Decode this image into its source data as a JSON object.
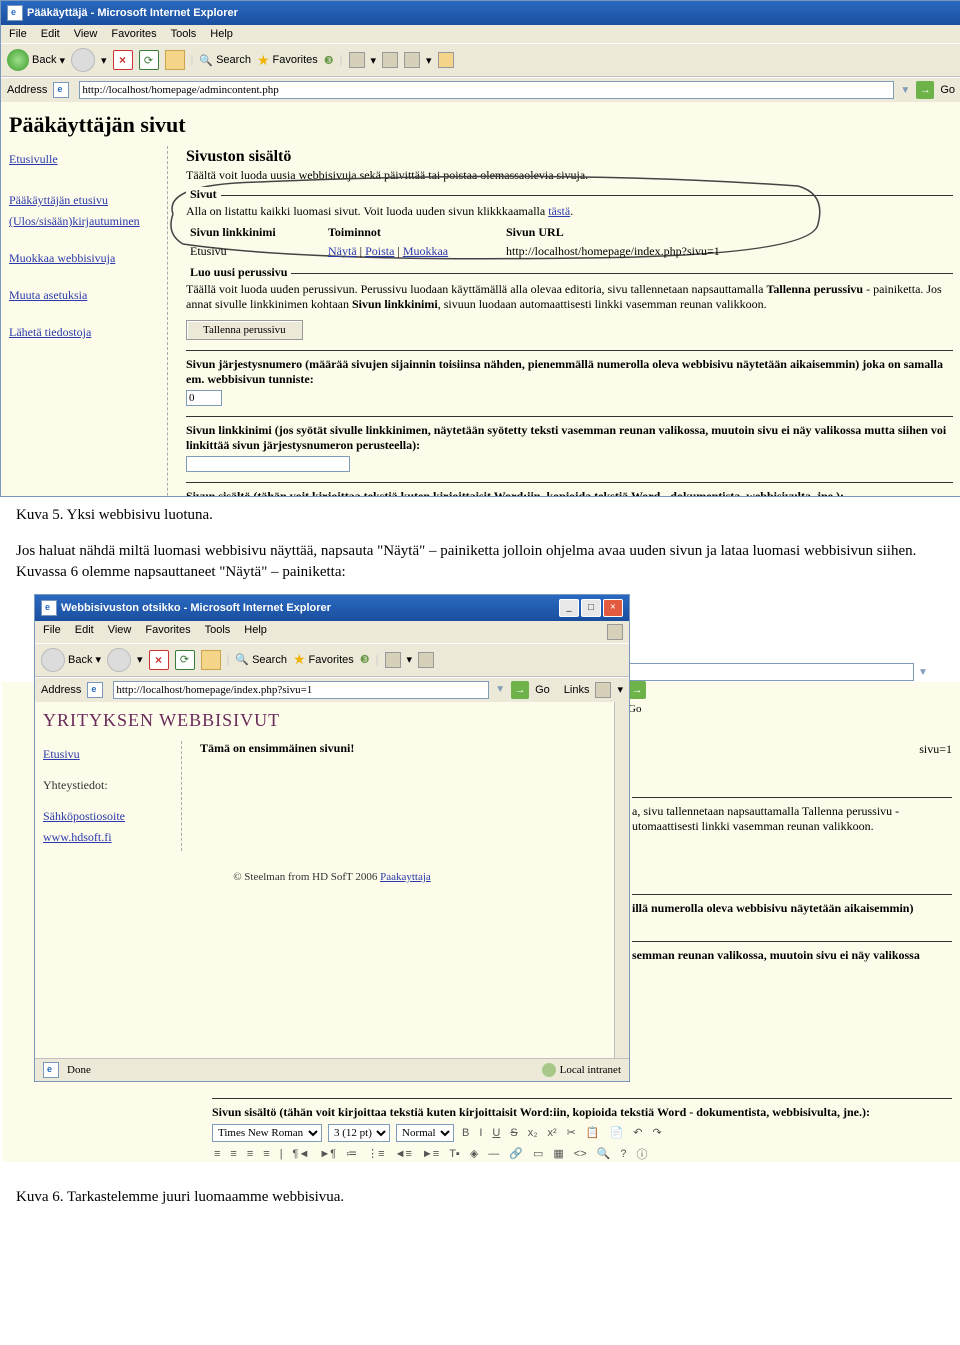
{
  "ie1": {
    "title": "Pääkäyttäjä - Microsoft Internet Explorer",
    "menu": [
      "File",
      "Edit",
      "View",
      "Favorites",
      "Tools",
      "Help"
    ],
    "toolbar": {
      "back": "Back",
      "search": "Search",
      "favorites": "Favorites"
    },
    "address_label": "Address",
    "address_url": "http://localhost/homepage/admincontent.php",
    "go": "Go"
  },
  "page1": {
    "title": "Pääkäyttäjän sivut",
    "side": {
      "home": "Etusivulle",
      "admin": "Pääkäyttäjän etusivu",
      "logout": "(Ulos/sisään)kirjautuminen",
      "edit": "Muokkaa webbisivuja",
      "settings": "Muuta asetuksia",
      "upload": "Lähetä tiedostoja"
    },
    "h2": "Sivuston sisältö",
    "intro": "Täältä voit luoda uusia webbisivuja sekä päivittää tai poistaa olemassaolevia sivuja.",
    "fs1": "Sivut",
    "fs1_txt": "Alla on listattu kaikki luomasi sivut. Voit luoda uuden sivun klikkkaamalla ",
    "fs1_link": "tästä",
    "th": {
      "c1": "Sivun linkkinimi",
      "c2": "Toiminnot",
      "c3": "Sivun URL"
    },
    "row": {
      "c1": "Etusivu",
      "a1": "Näytä",
      "a2": "Poista",
      "a3": "Muokkaa",
      "url": "http://localhost/homepage/index.php?sivu=1"
    },
    "fs2": "Luo uusi perussivu",
    "fs2_txt": "Täällä voit luoda uuden perussivun. Perussivu luodaan käyttämällä alla olevaa editoria, sivu tallennetaan napsauttamalla ",
    "fs2_bold": "Tallenna perussivu",
    "fs2_txt2": " - painiketta. Jos annat sivulle linkkinimen kohtaan ",
    "fs2_bold2": "Sivun linkkinimi",
    "fs2_txt3": ", sivuun luodaan automaattisesti linkki vasemman reunan valikkoon.",
    "btn": "Tallenna perussivu",
    "para1a": "Sivun järjestysnumero (määrää sivujen sijainnin toisiinsa nähden, pienemmällä numerolla oleva webbisivu näytetään aikaisemmin) joka on samalla em. webbisivun tunniste:",
    "para1_val": "0",
    "para2": "Sivun linkkinimi (jos syötät sivulle linkkinimen, näytetään syötetty teksti vasemman reunan valikossa, muutoin sivu ei näy valikossa mutta siihen voi linkittää sivun järjestysnumeron perusteella):",
    "para3": "Sivun sisältö (tähän voit kirjoittaa tekstiä kuten kirjoittaisit Word:iin, kopioida tekstiä Word - dokumentista, webbisivulta, jne.):",
    "editor": {
      "font": "Times New Roman",
      "size": "3 (12 pt)",
      "style": "Normal"
    }
  },
  "caption1": "Kuva 5. Yksi webbisivu luotuna.",
  "docpara": "Jos haluat nähdä miltä luomasi webbisivu näyttää, napsauta \"Näytä\" – painiketta jolloin ohjelma avaa uuden sivun ja lataa luomasi webbisivun siihen. Kuvassa 6 olemme napsauttaneet \"Näytä\" – painiketta:",
  "ie2": {
    "title": "Webbisivuston otsikko - Microsoft Internet Explorer",
    "address_url": "http://localhost/homepage/index.php?sivu=1",
    "links": "Links",
    "done": "Done",
    "intranet": "Local intranet"
  },
  "page2": {
    "title": "YRITYKSEN WEBBISIVUT",
    "side": {
      "home": "Etusivu",
      "contact": "Yhteystiedot:",
      "email": "Sähköpostiosoite",
      "www": "www.hdsoft.fi"
    },
    "body": "Tämä on ensimmäinen sivuni!",
    "footer": "© Steelman from HD SofT 2006 ",
    "footer_link": "Paakayttaja"
  },
  "behind": {
    "sivu": "sivu=1",
    "t1": "a, sivu tallennetaan napsauttamalla Tallenna perussivu - utomaattisesti linkki vasemman reunan valikkoon.",
    "t2": "illä numerolla oleva webbisivu näytetään aikaisemmin)",
    "t3": "semman reunan valikossa, muutoin sivu ei näy valikossa"
  },
  "caption2": "Kuva 6. Tarkastelemme juuri luomaamme webbisivua."
}
